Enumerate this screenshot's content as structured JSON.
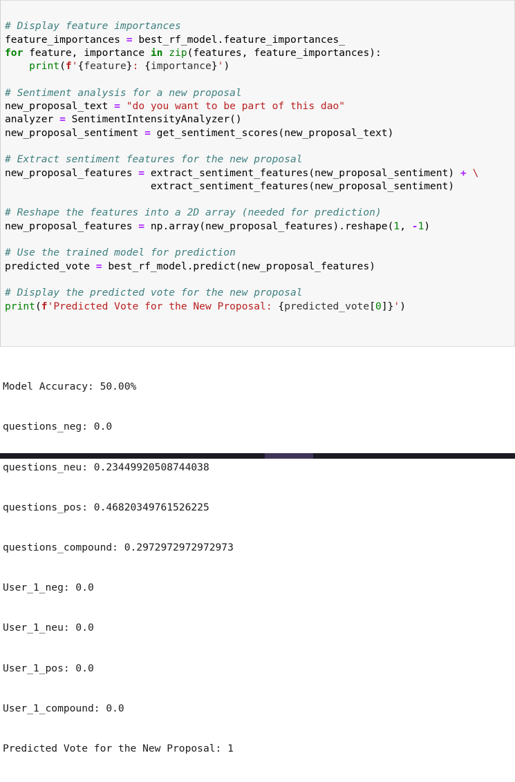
{
  "cell": {
    "background": "#f7f7f7",
    "border_color": "#dcdcdc",
    "lines": [
      "# Display feature importances",
      "feature_importances = best_rf_model.feature_importances_",
      "for feature, importance in zip(features, feature_importances):",
      "    print(f'{feature}: {importance}')",
      "",
      "# Sentiment analysis for a new proposal",
      "new_proposal_text = \"do you want to be part of this dao\"",
      "analyzer = SentimentIntensityAnalyzer()",
      "new_proposal_sentiment = get_sentiment_scores(new_proposal_text)",
      "",
      "# Extract sentiment features for the new proposal",
      "new_proposal_features = extract_sentiment_features(new_proposal_sentiment) + \\",
      "                        extract_sentiment_features(new_proposal_sentiment)",
      "",
      "# Reshape the features into a 2D array (needed for prediction)",
      "new_proposal_features = np.array(new_proposal_features).reshape(1, -1)",
      "",
      "# Use the trained model for prediction",
      "predicted_vote = best_rf_model.predict(new_proposal_features)",
      "",
      "# Display the predicted vote for the new proposal",
      "print(f'Predicted Vote for the New Proposal: {predicted_vote[0]}')"
    ],
    "syntax_colors": {
      "comment": "#408080",
      "keyword": "#008000",
      "builtin": "#008000",
      "string": "#ba2121",
      "operator": "#aa22ff",
      "number": "#008000",
      "name": "#000000"
    }
  },
  "output": {
    "lines": [
      "Model Accuracy: 50.00%",
      "questions_neg: 0.0",
      "questions_neu: 0.23449920508744038",
      "questions_pos: 0.46820349761526225",
      "questions_compound: 0.2972972972972973",
      "User_1_neg: 0.0",
      "User_1_neu: 0.0",
      "User_1_pos: 0.0",
      "User_1_compound: 0.0",
      "Predicted Vote for the New Proposal: 1"
    ],
    "metrics": {
      "model_accuracy": "50.00%",
      "questions_neg": "0.0",
      "questions_neu": "0.23449920508744038",
      "questions_pos": "0.46820349761526225",
      "questions_compound": "0.2972972972972973",
      "User_1_neg": "0.0",
      "User_1_neu": "0.0",
      "User_1_pos": "0.0",
      "User_1_compound": "0.0",
      "predicted_vote": "1"
    }
  },
  "taskbar": {
    "background": "#1b1b24",
    "accent": "#3f3356"
  }
}
